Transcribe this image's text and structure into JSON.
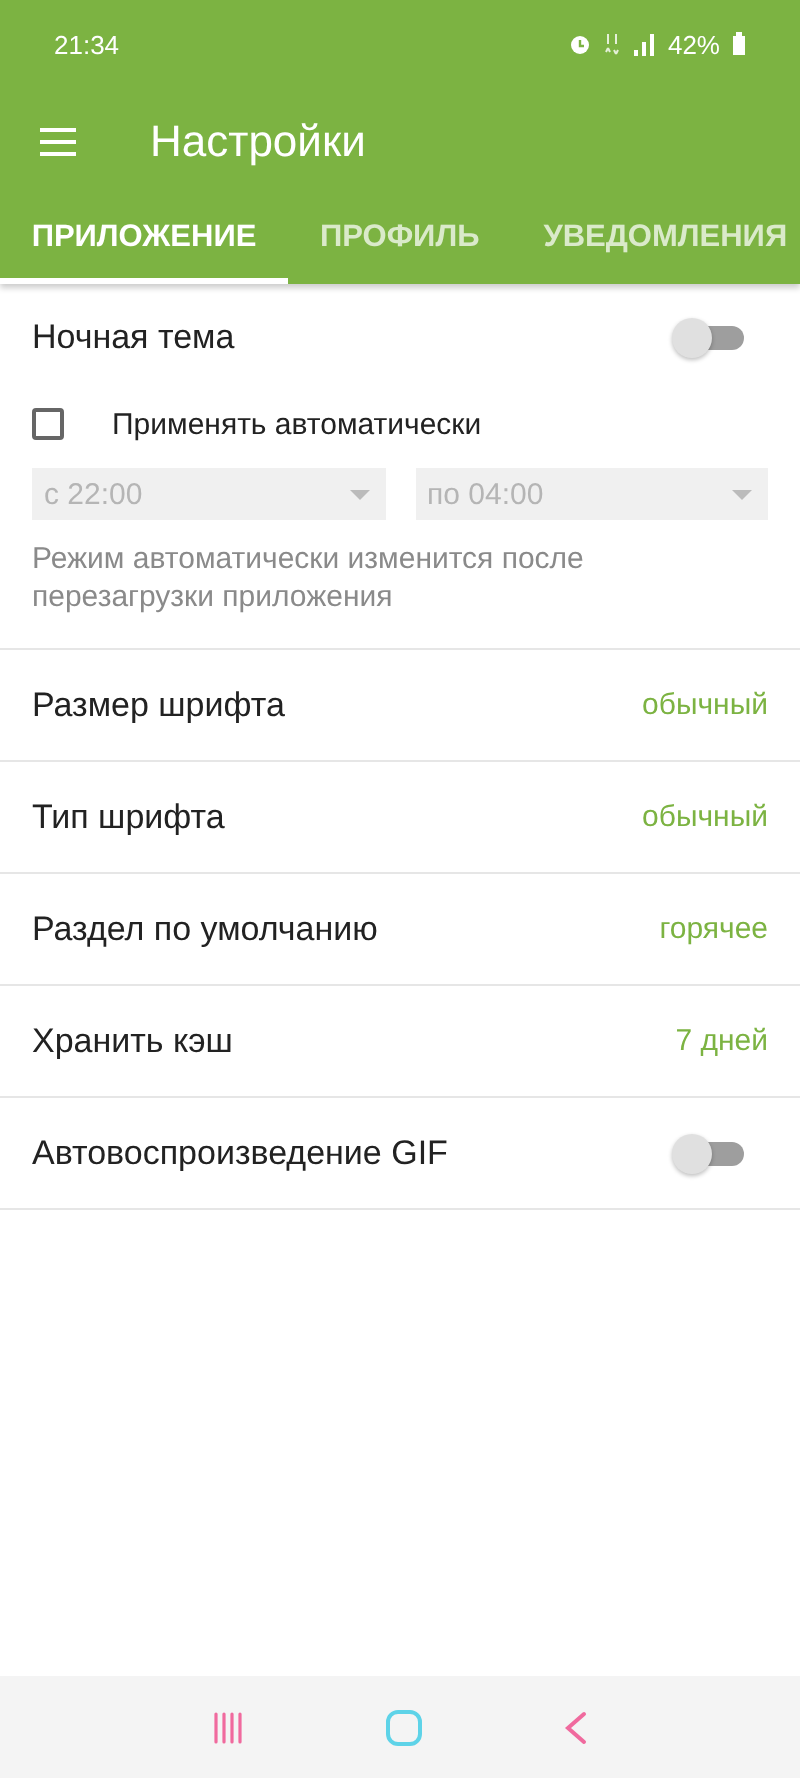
{
  "status_bar": {
    "time": "21:34",
    "battery": "42%"
  },
  "app_bar": {
    "title": "Настройки"
  },
  "tabs": [
    {
      "label": "ПРИЛОЖЕНИЕ",
      "selected": true
    },
    {
      "label": "ПРОФИЛЬ",
      "selected": false
    },
    {
      "label": "УВЕДОМЛЕНИЯ",
      "selected": false
    }
  ],
  "night_theme": {
    "label": "Ночная тема",
    "on": false,
    "auto": {
      "label": "Применять автоматически",
      "checked": false
    },
    "time_fields": [
      {
        "value": "с 22:00",
        "disabled": true
      },
      {
        "value": "по 04:00",
        "disabled": true
      }
    ],
    "note": "Режим автоматически изменится после перезагрузки приложения"
  },
  "settings": [
    {
      "kind": "value",
      "label": "Размер шрифта",
      "value": "обычный"
    },
    {
      "kind": "value",
      "label": "Тип шрифта",
      "value": "обычный"
    },
    {
      "kind": "value",
      "label": "Раздел по умолчанию",
      "value": "горячее"
    },
    {
      "kind": "value",
      "label": "Хранить кэш",
      "value": "7 дней"
    },
    {
      "kind": "switch",
      "label": "Автовоспроизведение GIF",
      "on": false
    }
  ]
}
